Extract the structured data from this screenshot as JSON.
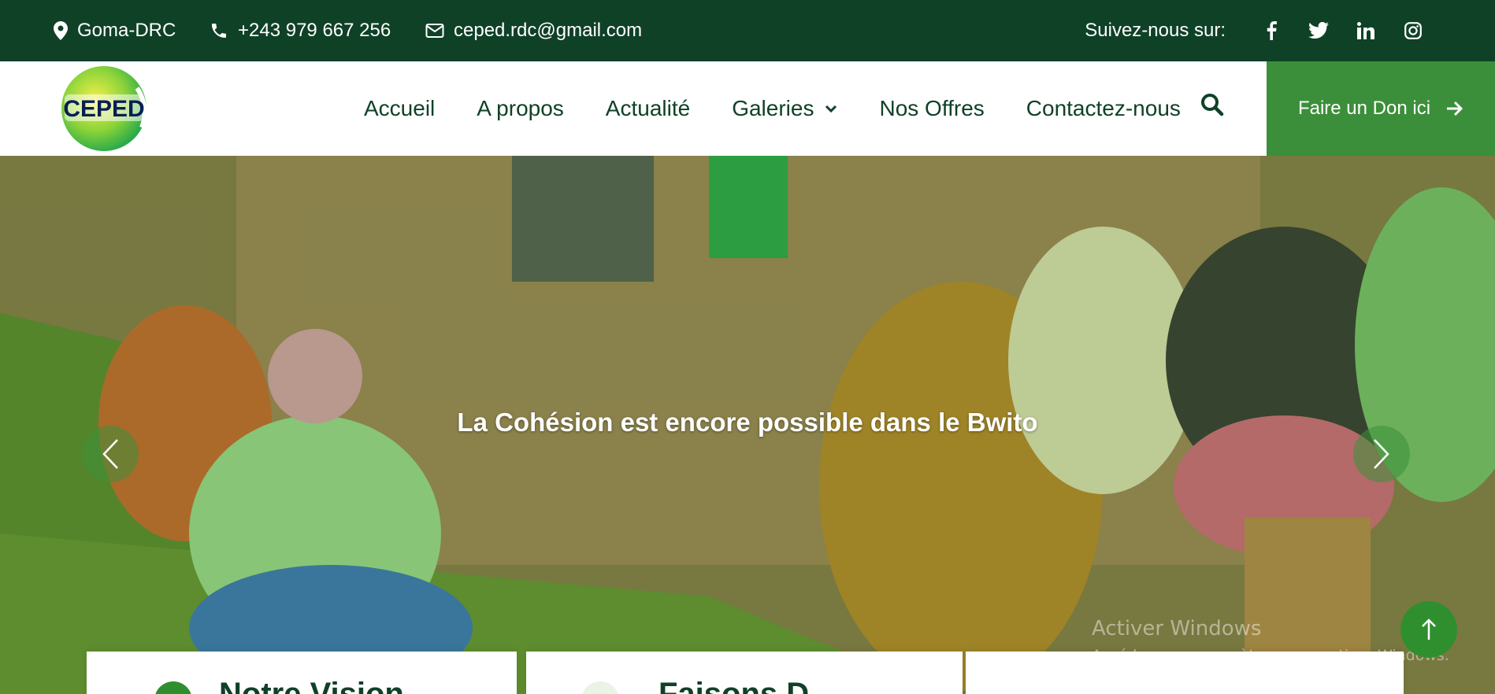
{
  "topbar": {
    "location": "Goma-DRC",
    "phone": "+243 979 667 256",
    "email": "ceped.rdc@gmail.com",
    "follow_label": "Suivez-nous sur:",
    "social_icons": [
      "facebook-icon",
      "twitter-icon",
      "linkedin-icon",
      "instagram-icon"
    ]
  },
  "brand": {
    "logo_text": "CEPED"
  },
  "nav": {
    "items": [
      "Accueil",
      "A propos",
      "Actualité",
      "Galeries",
      "Nos Offres",
      "Contactez-nous"
    ],
    "donate_label": "Faire un Don ici"
  },
  "hero": {
    "title": "La Cohésion est encore possible dans le Bwito"
  },
  "cards": [
    {
      "title": "Notre Vision"
    },
    {
      "title": "Faisons D"
    },
    {
      "title": ""
    }
  ],
  "watermark": {
    "line1": "Activer Windows",
    "line2": "Accédez aux paramètres pour activer Windows."
  },
  "colors": {
    "topbar_bg": "#0f4127",
    "accent_green": "#3c8f3a",
    "nav_text": "#0f4127"
  }
}
